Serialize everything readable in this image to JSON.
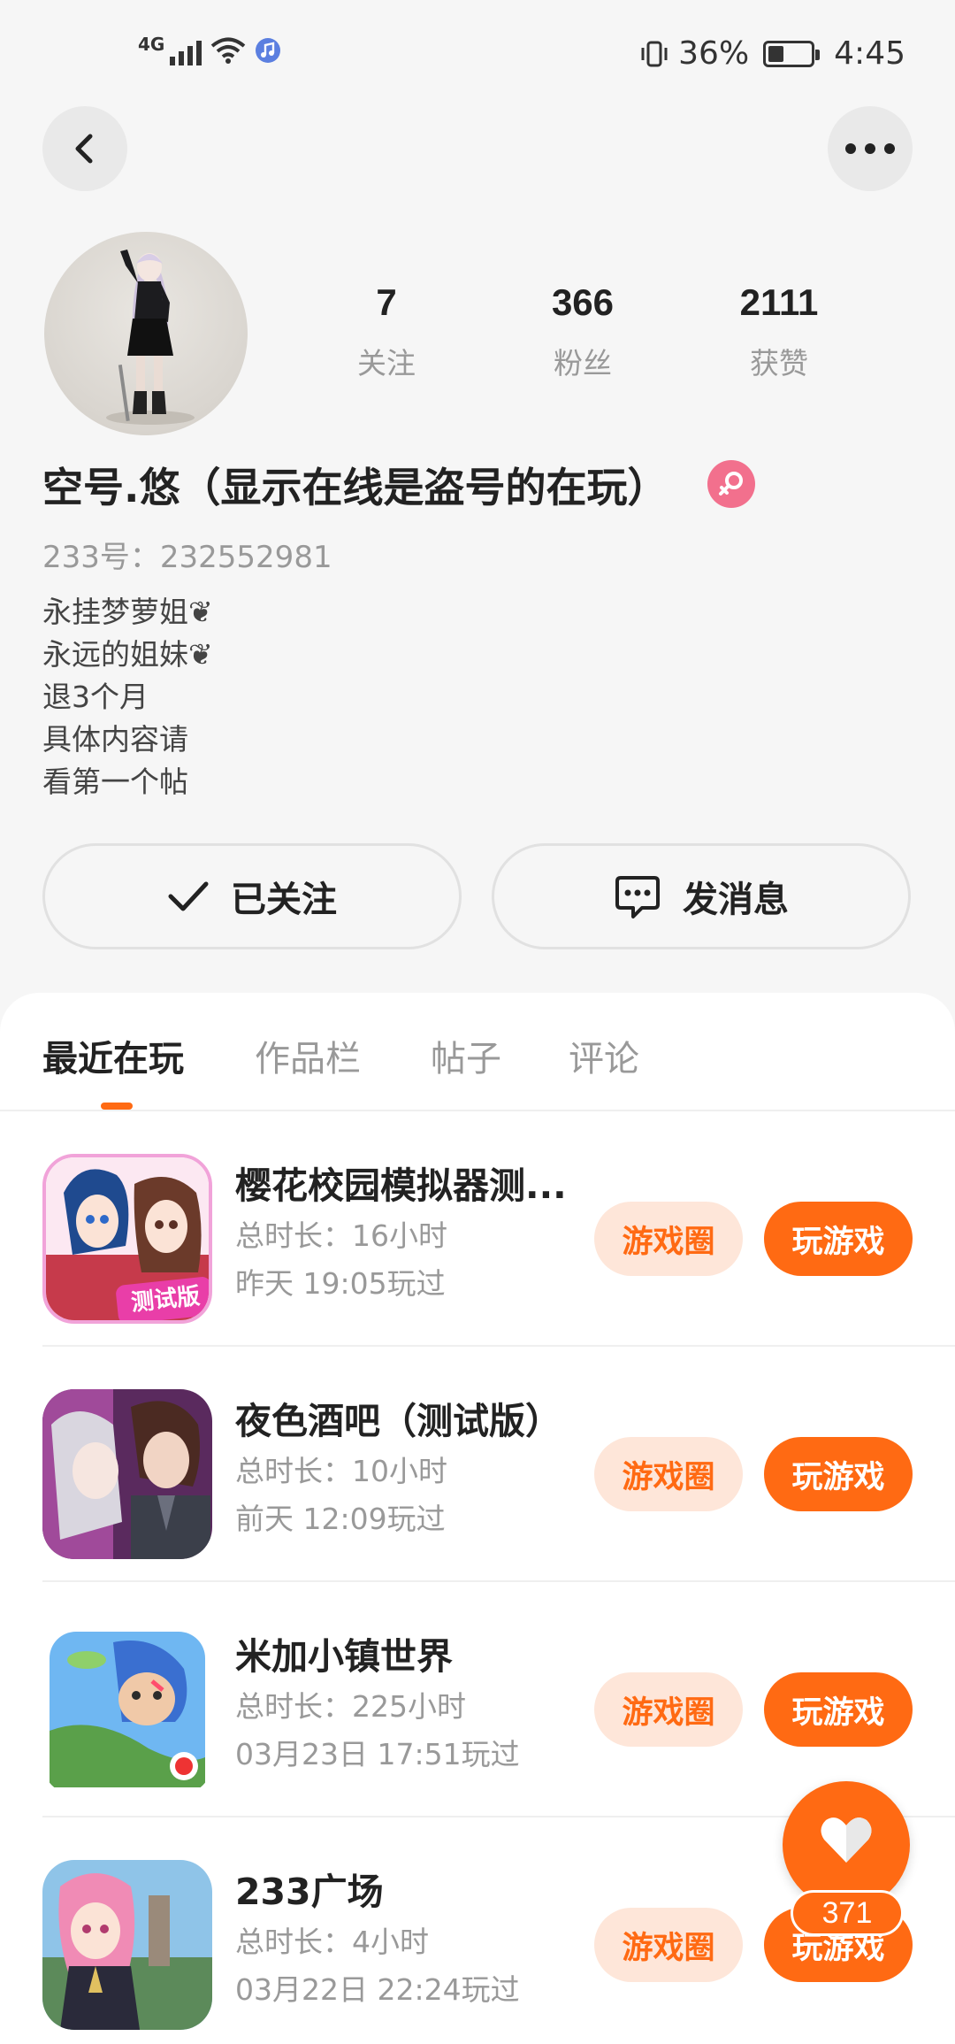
{
  "status_bar": {
    "network": "4G",
    "battery": "36%",
    "battery_level": 0.36,
    "time": "4:45"
  },
  "header": {
    "back_icon": "chevron-left-icon",
    "more_icon": "more-dots-icon"
  },
  "profile": {
    "stats": [
      {
        "value": "7",
        "label": "关注"
      },
      {
        "value": "366",
        "label": "粉丝"
      },
      {
        "value": "2111",
        "label": "获赞"
      }
    ],
    "nickname": "空号.悠（显示在线是盗号的在玩）",
    "gender_icon": "female-icon",
    "uid": "233号：232552981",
    "bio": [
      "永挂梦萝姐❦",
      "永远的姐妹❦",
      "退3个月",
      "具体内容请",
      "看第一个帖"
    ],
    "follow_label": "已关注",
    "message_label": "发消息"
  },
  "tabs": [
    {
      "label": "最近在玩",
      "active": true
    },
    {
      "label": "作品栏",
      "active": false
    },
    {
      "label": "帖子",
      "active": false
    },
    {
      "label": "评论",
      "active": false
    }
  ],
  "games": [
    {
      "title": "樱花校园模拟器测...",
      "duration": "总时长：16小时",
      "last_played": "昨天 19:05玩过",
      "circle_label": "游戏圈",
      "play_label": "玩游戏",
      "icon_badge": "测试版"
    },
    {
      "title": "夜色酒吧（测试版）",
      "duration": "总时长：10小时",
      "last_played": "前天 12:09玩过",
      "circle_label": "游戏圈",
      "play_label": "玩游戏"
    },
    {
      "title": "米加小镇世界",
      "duration": "总时长：225小时",
      "last_played": "03月23日 17:51玩过",
      "circle_label": "游戏圈",
      "play_label": "玩游戏"
    },
    {
      "title": "233广场",
      "duration": "总时长：4小时",
      "last_played": "03月22日 22:24玩过",
      "circle_label": "游戏圈",
      "play_label": "玩游戏"
    }
  ],
  "like_button": {
    "icon": "heart-icon",
    "count": "371"
  },
  "colors": {
    "accent": "#ff6a13",
    "accent_light": "#fee6d9",
    "gender_pink": "#f2708d"
  }
}
